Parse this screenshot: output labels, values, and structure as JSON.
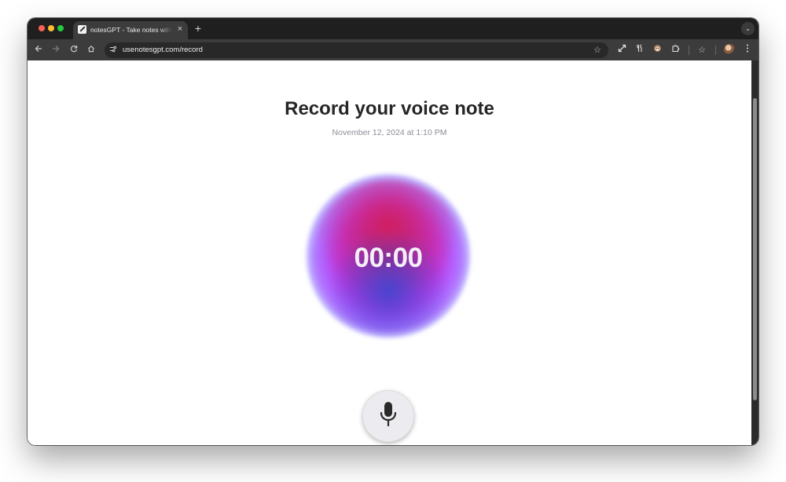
{
  "browser": {
    "tab": {
      "title": "notesGPT - Take notes with your voice",
      "close_glyph": "×"
    },
    "new_tab_glyph": "+",
    "tab_search_glyph": "⌄",
    "url": "usenotesgpt.com/record",
    "toolbar_icons": [
      "back-arrow-icon",
      "forward-arrow-icon",
      "reload-icon",
      "home-icon",
      "site-info-icon",
      "bookmark-star-icon",
      "expand-icon",
      "extension-fork-knife-icon",
      "extension-monkey-icon",
      "extensions-puzzle-icon",
      "bookmarks-star-icon",
      "profile-avatar",
      "more-menu-icon"
    ]
  },
  "page": {
    "title": "Record your voice note",
    "date": "November 12, 2024 at 1:10 PM",
    "timer": "00:00",
    "record_button_icon": "microphone-icon"
  },
  "colors": {
    "orb_red": "#d21e5a",
    "orb_purple": "#be32dc",
    "orb_blue": "#3c46d2",
    "traffic_red": "#fe5f57",
    "traffic_yellow": "#febc2e",
    "traffic_green": "#28c840"
  }
}
